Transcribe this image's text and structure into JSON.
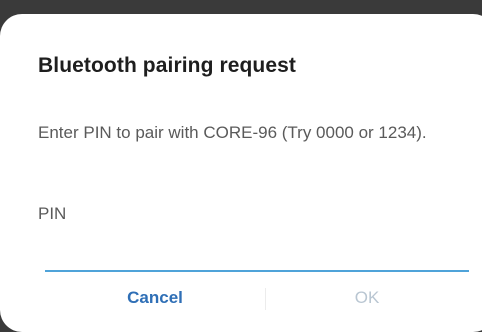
{
  "dialog": {
    "title": "Bluetooth pairing request",
    "message": "Enter PIN to pair with CORE-96 (Try 0000 or 1234).",
    "pin_label": "PIN",
    "pin_value": "",
    "cancel_label": "Cancel",
    "ok_label": "OK"
  },
  "colors": {
    "accent": "#4fa3d9",
    "cancel_text": "#2f6fb6",
    "ok_disabled_text": "#b9c6d2"
  }
}
